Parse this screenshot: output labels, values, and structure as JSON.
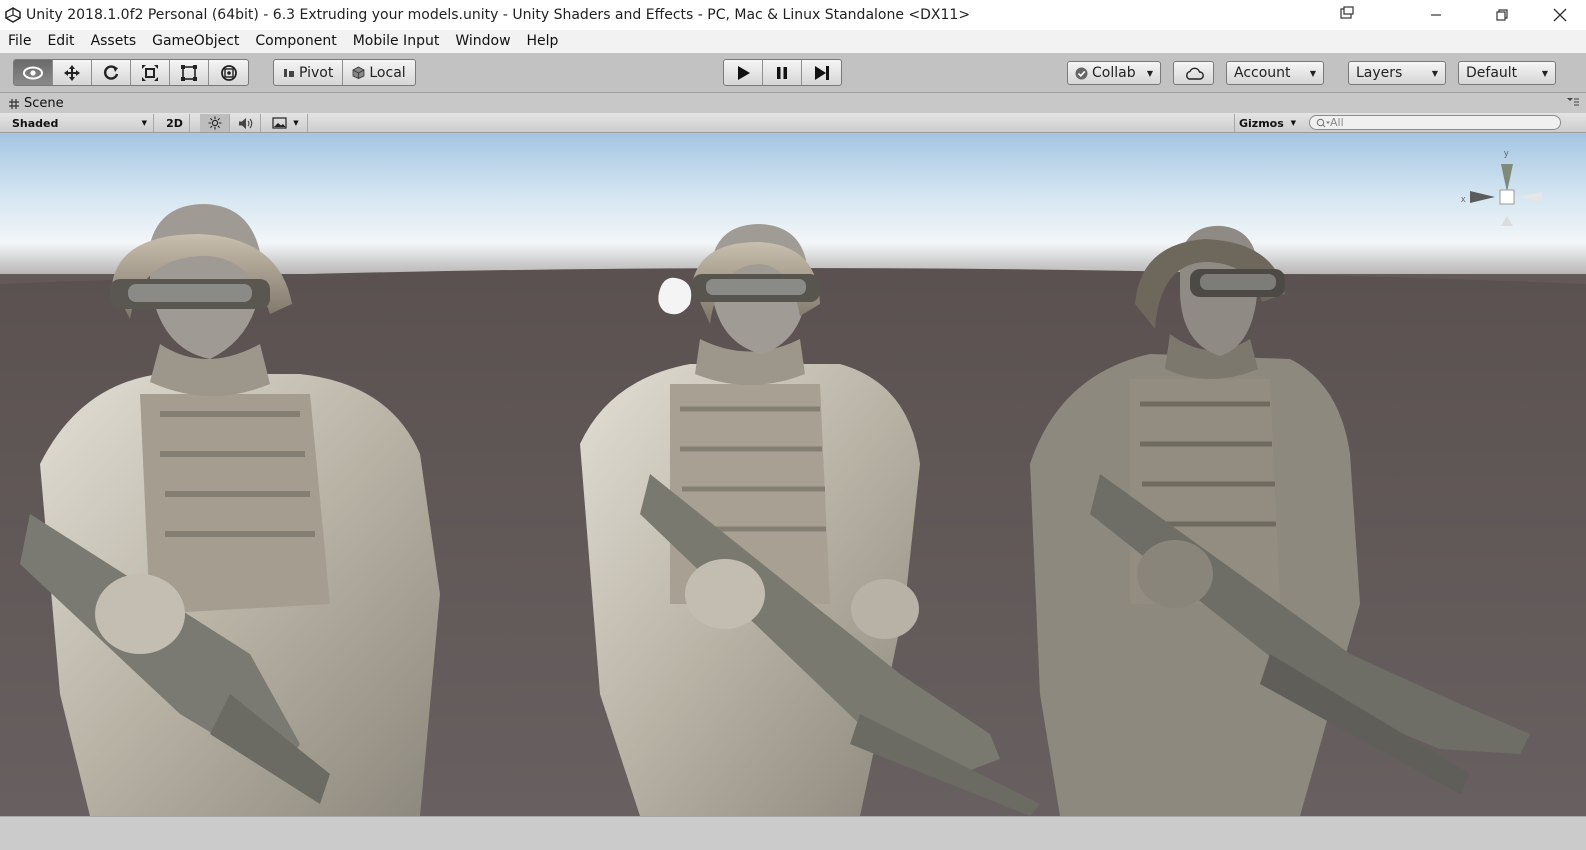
{
  "window": {
    "title": "Unity 2018.1.0f2 Personal (64bit) - 6.3 Extruding your models.unity - Unity Shaders and Effects - PC, Mac & Linux Standalone <DX11>",
    "controls": [
      "minimize-icon",
      "restore-icon",
      "close-icon"
    ]
  },
  "menu": {
    "items": [
      "File",
      "Edit",
      "Assets",
      "GameObject",
      "Component",
      "Mobile Input",
      "Window",
      "Help"
    ]
  },
  "toolbar": {
    "transform_tools": [
      "hand-view-icon",
      "move-icon",
      "rotate-icon",
      "scale-icon",
      "rect-icon",
      "transform-all-icon"
    ],
    "pivot_label": "Pivot",
    "local_label": "Local",
    "play_controls": [
      "play-icon",
      "pause-icon",
      "step-icon"
    ],
    "collab_label": "Collab",
    "account_label": "Account",
    "layers_label": "Layers",
    "layout_label": "Default"
  },
  "scene": {
    "tab_label": "Scene",
    "shading_mode": "Shaded",
    "mode_2d": "2D",
    "gizmos_label": "Gizmos",
    "search_placeholder": "All",
    "axis_y": "y",
    "axis_x": "x"
  },
  "colors": {
    "sky_top": "#a9cbe6",
    "horizon": "#eef3f7",
    "ground": "#625958",
    "editor_gray": "#c2c2c2"
  },
  "viewport_content": {
    "objects": [
      "soldier-model-left",
      "soldier-model-center",
      "soldier-model-right"
    ]
  }
}
